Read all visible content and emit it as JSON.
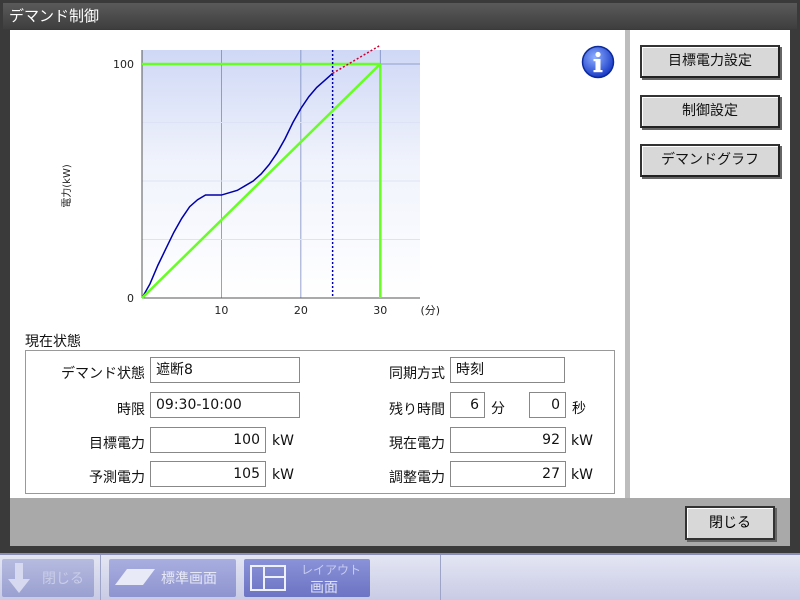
{
  "window": {
    "title": "デマンド制御"
  },
  "side_buttons": [
    "目標電力設定",
    "制御設定",
    "デマンドグラフ"
  ],
  "chart_data": {
    "type": "line",
    "ylabel": "電力(kW)",
    "xlabel": "(分)",
    "xlim": [
      0,
      35
    ],
    "ylim": [
      0,
      100
    ],
    "x_ticks": [
      "10",
      "20",
      "30"
    ],
    "y_ticks": [
      "0",
      "100"
    ],
    "x_unit_label": "(分)",
    "series": [
      {
        "color": "#0000aa",
        "style": "solid",
        "x": [
          0,
          1,
          2,
          3,
          4,
          5,
          6,
          7,
          8,
          9,
          10,
          11,
          12,
          13,
          14,
          15,
          16,
          17,
          18,
          19,
          20,
          21,
          22,
          23,
          24
        ],
        "y": [
          0,
          6,
          14,
          21,
          28,
          34,
          39,
          42,
          44,
          44,
          44,
          45,
          46,
          48,
          50,
          53,
          57,
          62,
          68,
          75,
          81,
          86,
          90,
          93,
          96
        ]
      },
      {
        "color": "#cc0033",
        "style": "dotted",
        "x": [
          24,
          25,
          26,
          27,
          28,
          29,
          30
        ],
        "y": [
          96,
          98,
          100,
          102,
          104,
          106,
          108
        ]
      },
      {
        "color": "#66ff22",
        "style": "solid",
        "x": [
          0,
          30
        ],
        "y": [
          0,
          100
        ]
      }
    ],
    "target": 100,
    "current_time_min": 24,
    "period_end_min": 30
  },
  "status": {
    "title": "現在状態",
    "demand_state_label": "デマンド状態",
    "demand_state_value": "遮断8",
    "sync_label": "同期方式",
    "sync_value": "時刻",
    "period_label": "時限",
    "period_value": "09:30-10:00",
    "remaining_label": "残り時間",
    "remaining_min": "6",
    "min_unit": "分",
    "remaining_sec": "0",
    "sec_unit": "秒",
    "target_label": "目標電力",
    "target_value": "100",
    "current_label": "現在電力",
    "current_value": "92",
    "forecast_label": "予測電力",
    "forecast_value": "105",
    "adjust_label": "調整電力",
    "adjust_value": "27",
    "kw": "kW"
  },
  "close_label": "閉じる",
  "taskbar": {
    "back": "閉じる",
    "standard": "標準画面",
    "layout_line1": "レイアウト",
    "layout_line2": "画面"
  }
}
